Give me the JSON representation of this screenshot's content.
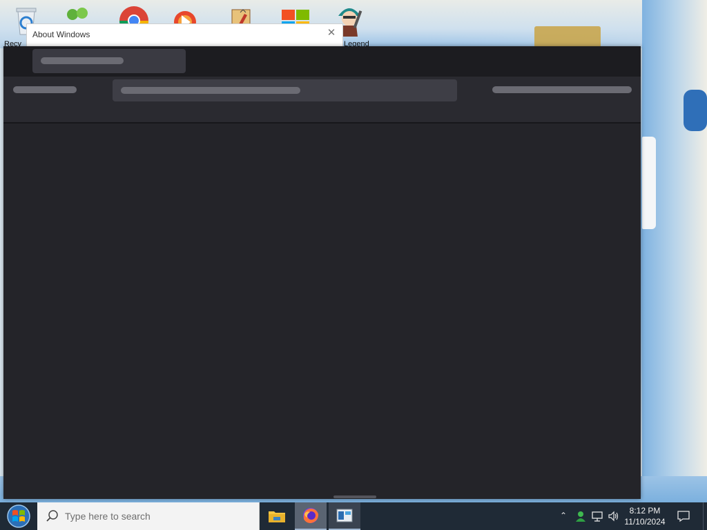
{
  "desktop": {
    "icons": [
      {
        "name": "recycle-bin",
        "label": "Recy"
      },
      {
        "name": "messenger",
        "label": ""
      },
      {
        "name": "chrome",
        "label": ""
      },
      {
        "name": "vlc",
        "label": ""
      },
      {
        "name": "app",
        "label": ""
      },
      {
        "name": "office",
        "label": ""
      },
      {
        "name": "game",
        "label": "Legend"
      }
    ]
  },
  "about_dialog": {
    "title": "About Windows",
    "close_glyph": "✕"
  },
  "taskbar": {
    "search_placeholder": "Type here to search",
    "tray_chevron": "⌃",
    "time": "8:12 PM",
    "date": "11/10/2024"
  }
}
